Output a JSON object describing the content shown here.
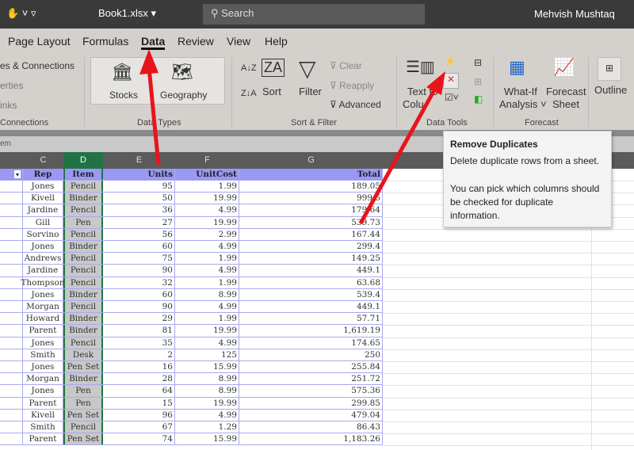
{
  "titlebar": {
    "file": "Book1.xlsx ▾",
    "search": "Search",
    "user": "Mehvish Mushtaq"
  },
  "tabs": [
    "Page Layout",
    "Formulas",
    "Data",
    "Review",
    "View",
    "Help"
  ],
  "ribbon": {
    "queries": {
      "items": [
        "es & Connections",
        "erties",
        "inks"
      ],
      "group": "Connections"
    },
    "datatypes": {
      "stocks": "Stocks",
      "geography": "Geography",
      "group": "Data Types"
    },
    "sortfilter": {
      "sort": "Sort",
      "filter": "Filter",
      "clear": "Clear",
      "reapply": "Reapply",
      "advanced": "Advanced",
      "group": "Sort & Filter"
    },
    "datatools": {
      "text1": "Text to",
      "text2": "Colu",
      "group": "Data Tools"
    },
    "forecast": {
      "whatif1": "What-If",
      "whatif2": "Analysis ˅",
      "fs1": "Forecast",
      "fs2": "Sheet",
      "group": "Forecast"
    },
    "outline": {
      "label": "Outline"
    }
  },
  "formula_bar": {
    "text": "em"
  },
  "columns": [
    "C",
    "D",
    "E",
    "F",
    "G"
  ],
  "table": {
    "headers": [
      "Rep",
      "Item",
      "Units",
      "UnitCost",
      "Total"
    ],
    "rows": [
      [
        "Jones",
        "Pencil",
        "95",
        "1.99",
        "189.05"
      ],
      [
        "Kivell",
        "Binder",
        "50",
        "19.99",
        "999.5"
      ],
      [
        "Jardine",
        "Pencil",
        "36",
        "4.99",
        "179.64"
      ],
      [
        "Gill",
        "Pen",
        "27",
        "19.99",
        "539.73"
      ],
      [
        "Sorvino",
        "Pencil",
        "56",
        "2.99",
        "167.44"
      ],
      [
        "Jones",
        "Binder",
        "60",
        "4.99",
        "299.4"
      ],
      [
        "Andrews",
        "Pencil",
        "75",
        "1.99",
        "149.25"
      ],
      [
        "Jardine",
        "Pencil",
        "90",
        "4.99",
        "449.1"
      ],
      [
        "Thompson",
        "Pencil",
        "32",
        "1.99",
        "63.68"
      ],
      [
        "Jones",
        "Binder",
        "60",
        "8.99",
        "539.4"
      ],
      [
        "Morgan",
        "Pencil",
        "90",
        "4.99",
        "449.1"
      ],
      [
        "Howard",
        "Binder",
        "29",
        "1.99",
        "57.71"
      ],
      [
        "Parent",
        "Binder",
        "81",
        "19.99",
        "1,619.19"
      ],
      [
        "Jones",
        "Pencil",
        "35",
        "4.99",
        "174.65"
      ],
      [
        "Smith",
        "Desk",
        "2",
        "125",
        "250"
      ],
      [
        "Jones",
        "Pen Set",
        "16",
        "15.99",
        "255.84"
      ],
      [
        "Morgan",
        "Binder",
        "28",
        "8.99",
        "251.72"
      ],
      [
        "Jones",
        "Pen",
        "64",
        "8.99",
        "575.36"
      ],
      [
        "Parent",
        "Pen",
        "15",
        "19.99",
        "299.85"
      ],
      [
        "Kivell",
        "Pen Set",
        "96",
        "4.99",
        "479.04"
      ],
      [
        "Smith",
        "Pencil",
        "67",
        "1.29",
        "86.43"
      ],
      [
        "Parent",
        "Pen Set",
        "74",
        "15.99",
        "1,183.26"
      ]
    ]
  },
  "tooltip": {
    "title": "Remove Duplicates",
    "line1": "Delete duplicate rows from a sheet.",
    "line2": "You can pick which columns should be checked for duplicate information."
  }
}
